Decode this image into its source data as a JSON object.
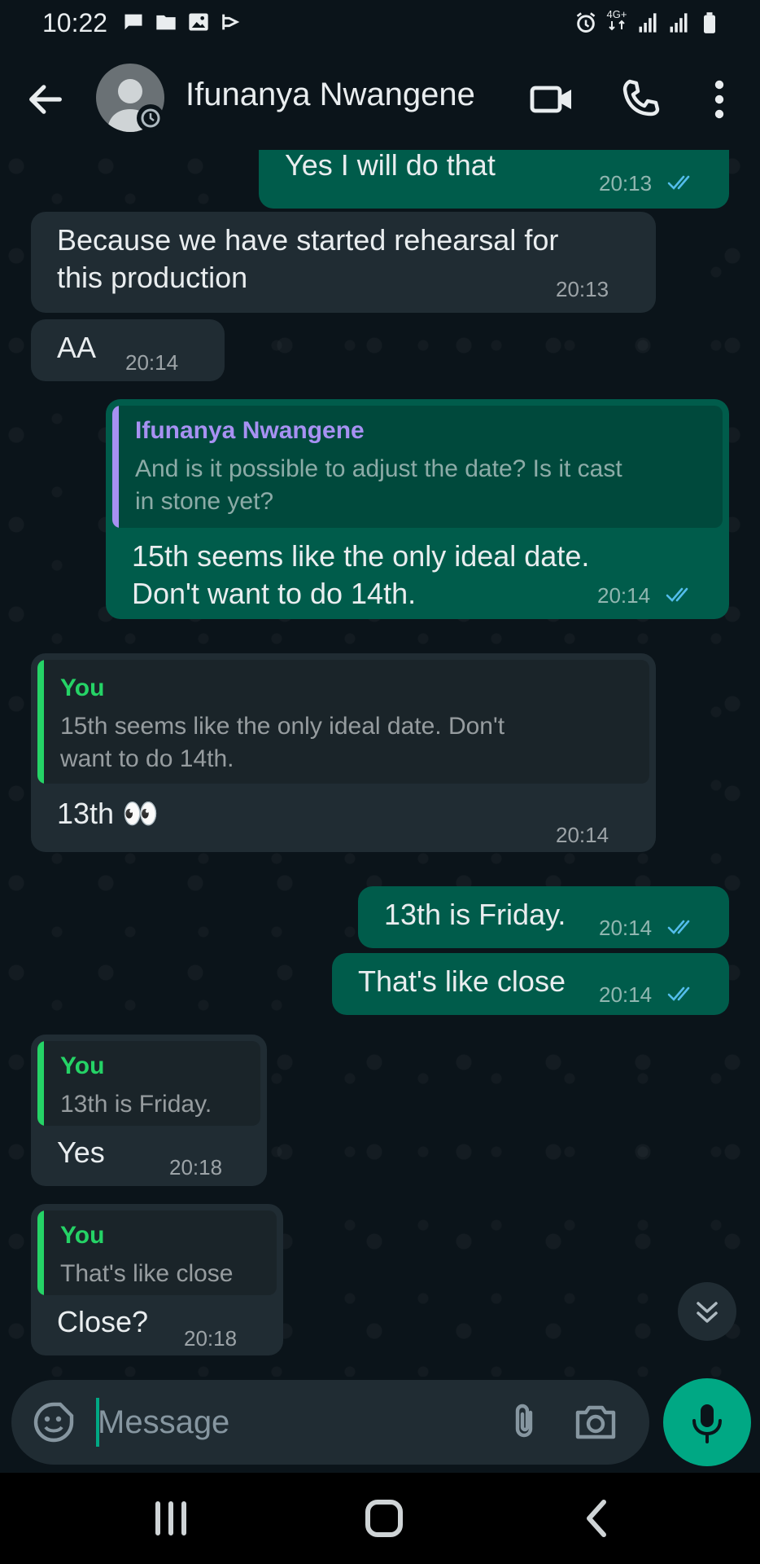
{
  "status_bar": {
    "time": "10:22",
    "network_label": "4G+",
    "icons_left": [
      "message-icon",
      "folder-icon",
      "image-icon",
      "cast-icon"
    ],
    "icons_right": [
      "alarm-icon",
      "network-4g-icon",
      "signal-icon",
      "signal-icon",
      "battery-icon"
    ]
  },
  "header": {
    "contact_name": "Ifunanya Nwangene",
    "actions": [
      "video-call-icon",
      "voice-call-icon",
      "more-options-icon"
    ]
  },
  "messages": [
    {
      "direction": "outgoing",
      "text": "Yes I will do that",
      "time": "20:13",
      "status": "read"
    },
    {
      "direction": "incoming",
      "text": "Because we have started rehearsal for\nthis production",
      "time": "20:13"
    },
    {
      "direction": "incoming",
      "text": "AA",
      "time": "20:14"
    },
    {
      "direction": "outgoing",
      "quote_author": "Ifunanya Nwangene",
      "quote_text": "And is it possible to adjust the date? Is it cast\nin stone yet?",
      "text": "15th seems like the only ideal date.\nDon't want to do 14th.",
      "time": "20:14",
      "status": "read"
    },
    {
      "direction": "incoming",
      "quote_author": "You",
      "quote_text": "15th seems like the only ideal date. Don't\nwant to do 14th.",
      "text": "13th 👀",
      "time": "20:14"
    },
    {
      "direction": "outgoing",
      "text": "13th is Friday.",
      "time": "20:14",
      "status": "read"
    },
    {
      "direction": "outgoing",
      "text": "That's like close",
      "time": "20:14",
      "status": "read"
    },
    {
      "direction": "incoming",
      "quote_author": "You",
      "quote_text": "13th is Friday.",
      "text": "Yes",
      "time": "20:18"
    },
    {
      "direction": "incoming",
      "quote_author": "You",
      "quote_text": "That's like close",
      "text": "Close?",
      "time": "20:18"
    }
  ],
  "composer": {
    "placeholder": "Message",
    "icons": [
      "emoji-sticker-icon",
      "attach-icon",
      "camera-icon",
      "mic-icon"
    ]
  },
  "colors": {
    "background": "#0b141a",
    "incoming_bubble": "#202c33",
    "outgoing_bubble": "#005c4b",
    "accent": "#00a884",
    "read_ticks": "#53bdeb",
    "quote_bar_contact": "#a791f2",
    "quote_bar_you": "#25d366"
  },
  "navigation_bar": [
    "recents-icon",
    "home-icon",
    "back-nav-icon"
  ]
}
